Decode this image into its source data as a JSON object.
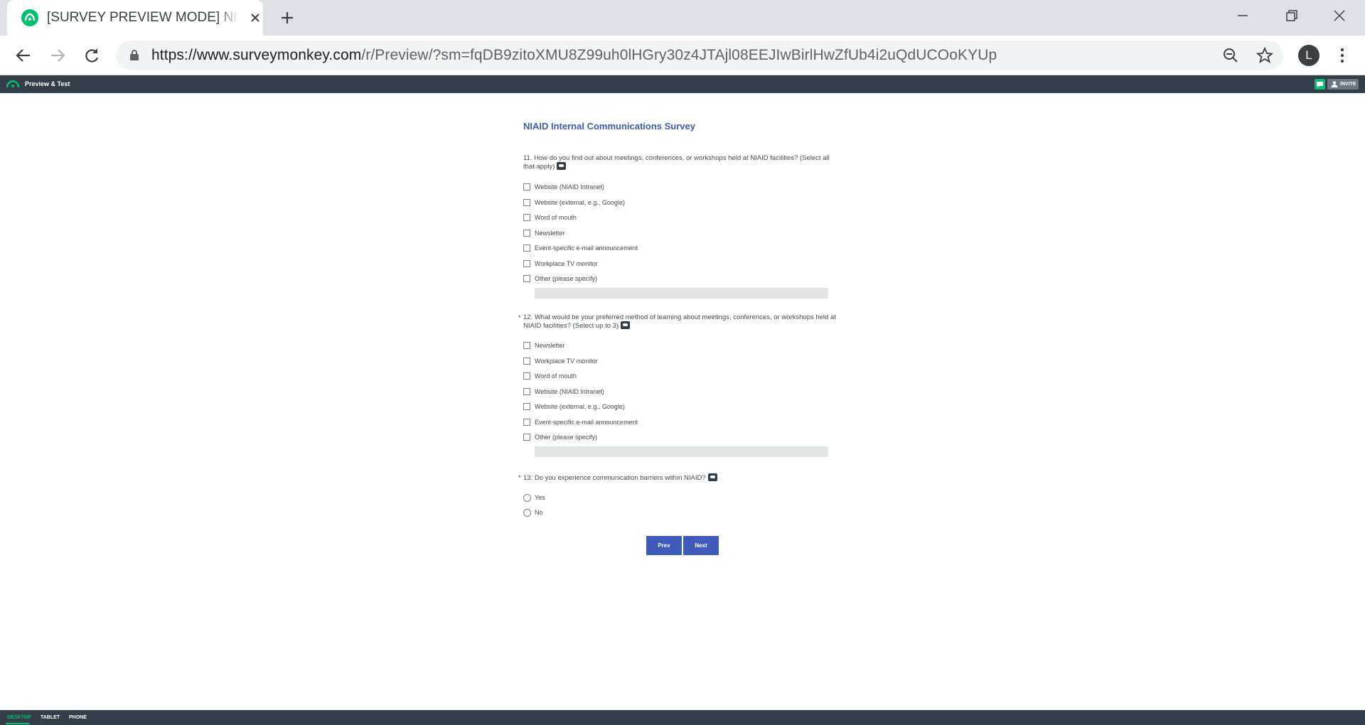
{
  "browser": {
    "tab_title": "[SURVEY PREVIEW MODE] NIAID Internal Communications Survey",
    "url_host": "https://www.surveymonkey.com",
    "url_rest": "/r/Preview/?sm=fqDB9zitoXMU8Z99uh0lHGry30z4JTAjl08EEJIwBirlHwZfUb4i2uQdUCOoKYUp",
    "profile_initial": "L"
  },
  "preview_bar": {
    "label": "Preview & Test",
    "invite_label": "INVITE"
  },
  "survey": {
    "title": "NIAID Internal Communications Survey",
    "q11": {
      "text": "11. How do you find out about meetings, conferences, or workshops held at NIAID facilities? (Select all that apply)",
      "options": [
        "Website (NIAID Intranet)",
        "Website (external, e.g., Google)",
        "Word of mouth",
        "Newsletter",
        "Event-specific e-mail announcement",
        "Workplace TV monitor",
        "Other (please specify)"
      ]
    },
    "q12": {
      "required_mark": "*",
      "text": "12. What would be your preferred method of learning about meetings, conferences, or workshops held at NIAID facilities? (Select up to 3)",
      "options": [
        "Newsletter",
        "Workplace TV monitor",
        "Word of mouth",
        "Website (NIAID Intranet)",
        "Website (external, e.g., Google)",
        "Event-specific e-mail announcement",
        "Other (please specify)"
      ]
    },
    "q13": {
      "required_mark": "*",
      "text": "13. Do you experience communication barriers within NIAID?",
      "options": [
        "Yes",
        "No"
      ]
    },
    "prev_label": "Prev",
    "next_label": "Next"
  },
  "device_bar": {
    "tabs": [
      "DESKTOP",
      "TABLET",
      "PHONE"
    ],
    "active": "DESKTOP"
  },
  "colors": {
    "brand_green": "#00bf6f",
    "survey_blue": "#3e5bb9",
    "dark_bar": "#333e48"
  }
}
